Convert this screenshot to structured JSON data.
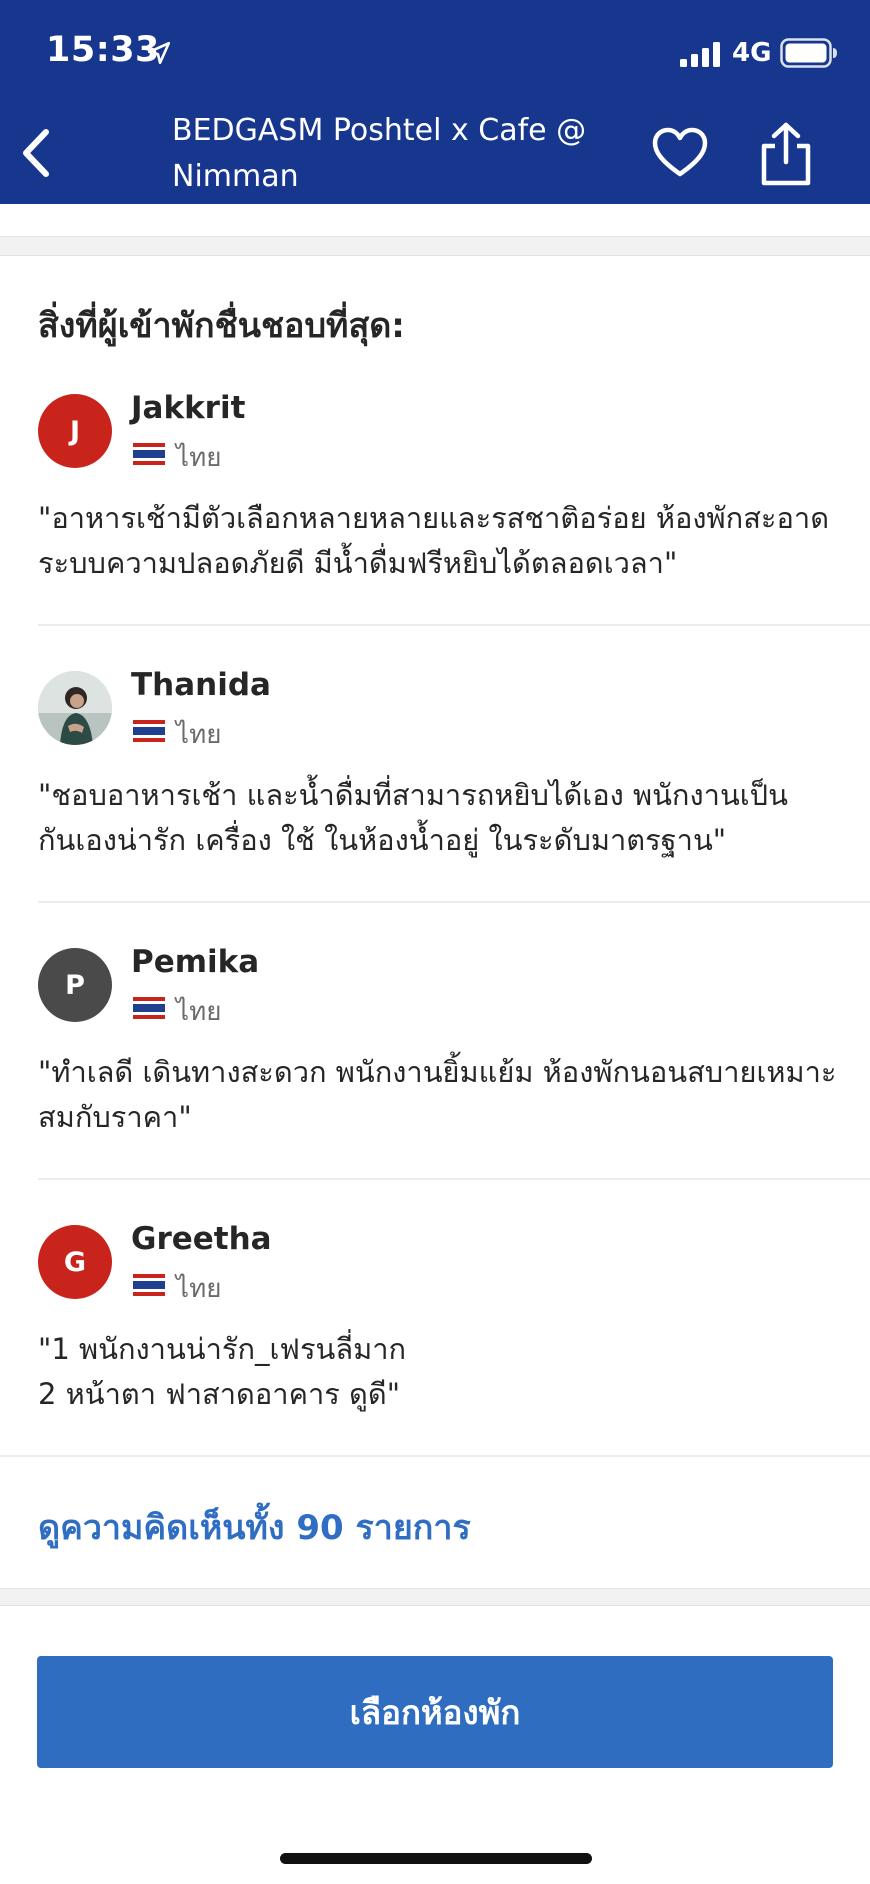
{
  "status_bar": {
    "time": "15:33",
    "network": "4G"
  },
  "header": {
    "title": "BEDGASM Poshtel x Cafe @ Nimman",
    "back_icon": "chevron-left-icon",
    "favorite_icon": "heart-icon",
    "share_icon": "share-icon"
  },
  "section": {
    "title": "สิ่งที่ผู้เข้าพักชื่นชอบที่สุด:"
  },
  "reviews": [
    {
      "name": "Jakkrit",
      "initial": "J",
      "avatar_color": "#c8241c",
      "country": "ไทย",
      "text": "\"อาหารเช้ามีตัวเลือกหลายหลายและรสชาติอร่อย ห้องพักสะอาด ระบบความปลอดภัยดี มีน้ำดื่มฟรีหยิบได้ตลอดเวลา\""
    },
    {
      "name": "Thanida",
      "initial": "",
      "avatar_color": "#cfd6d3",
      "country": "ไทย",
      "text": "\"ชอบอาหารเช้า และน้ำดื่มที่สามารถหยิบได้เอง  พนักงานเป็นกันเองน่ารัก  เครื่อง ใช้ ในห้องน้ำอยู่ ในระดับมาตรฐาน\""
    },
    {
      "name": "Pemika",
      "initial": "P",
      "avatar_color": "#4a4a4a",
      "country": "ไทย",
      "text": "\"ทำเลดี เดินทางสะดวก พนักงานยิ้มแย้ม ห้องพักนอนสบายเหมาะสมกับราคา\""
    },
    {
      "name": "Greetha",
      "initial": "G",
      "avatar_color": "#c8241c",
      "country": "ไทย",
      "text": "\"1 พนักงานน่ารัก_เฟรนลี่มาก\n2 หน้าตา ฟาสาดอาคาร ดูดี\""
    }
  ],
  "see_all": {
    "label": "ดูความคิดเห็นทั้ง 90 รายการ"
  },
  "cta": {
    "label": "เลือกห้องพัก"
  },
  "colors": {
    "header_bg": "#17378f",
    "link": "#2f6ec2",
    "button": "#2e6dbf"
  }
}
